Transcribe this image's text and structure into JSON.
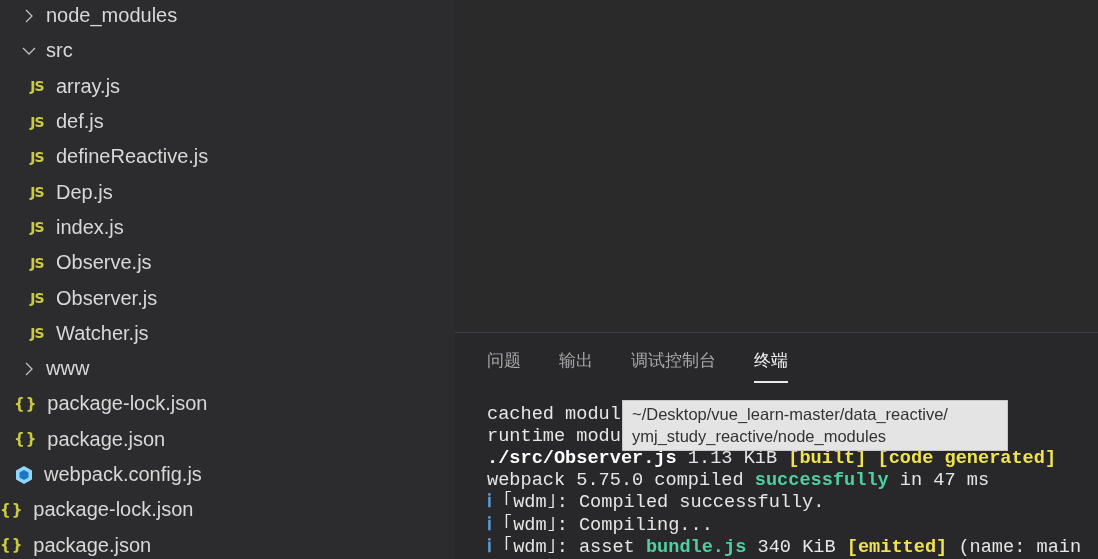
{
  "explorer": {
    "items": [
      {
        "kind": "group",
        "children": [
          {
            "kind": "folder",
            "name": "node_modules",
            "expanded": false
          },
          {
            "kind": "folder",
            "name": "src",
            "expanded": true,
            "children": [
              {
                "kind": "js",
                "icon": "JS",
                "name": "array.js"
              },
              {
                "kind": "js",
                "icon": "JS",
                "name": "def.js"
              },
              {
                "kind": "js",
                "icon": "JS",
                "name": "defineReactive.js"
              },
              {
                "kind": "js",
                "icon": "JS",
                "name": "Dep.js"
              },
              {
                "kind": "js",
                "icon": "JS",
                "name": "index.js"
              },
              {
                "kind": "js",
                "icon": "JS",
                "name": "Observe.js"
              },
              {
                "kind": "js",
                "icon": "JS",
                "name": "Observer.js"
              },
              {
                "kind": "js",
                "icon": "JS",
                "name": "Watcher.js"
              }
            ]
          },
          {
            "kind": "folder",
            "name": "www",
            "expanded": false
          },
          {
            "kind": "json",
            "icon": "{}",
            "name": "package-lock.json"
          },
          {
            "kind": "json",
            "icon": "{}",
            "name": "package.json"
          },
          {
            "kind": "webpack",
            "name": "webpack.config.js"
          }
        ]
      },
      {
        "kind": "json",
        "icon": "{}",
        "name": "package-lock.json"
      },
      {
        "kind": "json",
        "icon": "{}",
        "name": "package.json"
      }
    ]
  },
  "panel": {
    "tabs": [
      {
        "label": "问题",
        "selected": false
      },
      {
        "label": "输出",
        "selected": false
      },
      {
        "label": "调试控制台",
        "selected": false
      },
      {
        "label": "终端",
        "selected": true
      }
    ],
    "terminal": {
      "lines": [
        [
          {
            "kind": "plain",
            "text": "cached modul"
          }
        ],
        [
          {
            "kind": "plain",
            "text": "runtime modu"
          }
        ],
        [
          {
            "kind": "bold",
            "text": "./src/Observer.js"
          },
          {
            "kind": "plain",
            "text": " 1.13 KiB "
          },
          {
            "kind": "yellow",
            "text": "[built] [code generated]"
          }
        ],
        [
          {
            "kind": "plain",
            "text": "webpack 5.75.0 compiled "
          },
          {
            "kind": "green",
            "text": "successfully"
          },
          {
            "kind": "plain",
            "text": " in 47 ms"
          }
        ],
        [
          {
            "kind": "info",
            "text": "ℹ"
          },
          {
            "kind": "plain",
            "text": " ｢wdm｣: Compiled successfully."
          }
        ],
        [
          {
            "kind": "info",
            "text": "ℹ"
          },
          {
            "kind": "plain",
            "text": " ｢wdm｣: Compiling..."
          }
        ],
        [
          {
            "kind": "info",
            "text": "ℹ"
          },
          {
            "kind": "plain",
            "text": " ｢wdm｣: asset "
          },
          {
            "kind": "green",
            "text": "bundle.js"
          },
          {
            "kind": "plain",
            "text": " 340 KiB "
          },
          {
            "kind": "yellow",
            "text": "[emitted]"
          },
          {
            "kind": "plain",
            "text": " (name: main"
          }
        ]
      ]
    },
    "tooltip": {
      "lines": [
        "~/Desktop/vue_learn-master/data_reactive/",
        "ymj_study_reactive/node_modules"
      ]
    }
  }
}
